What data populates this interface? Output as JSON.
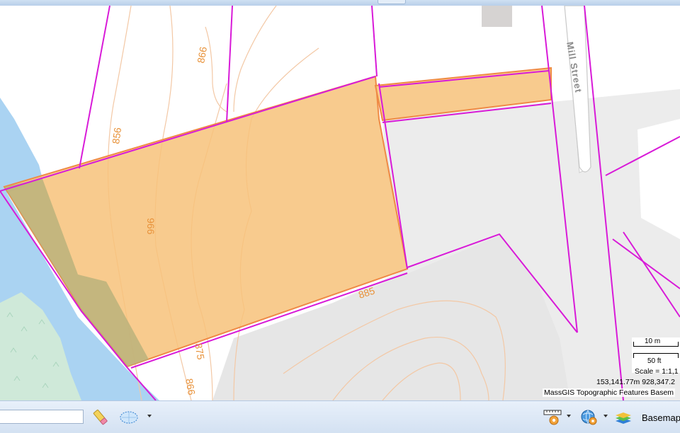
{
  "map": {
    "street_name": "Mill Street",
    "contour_labels": [
      "866",
      "856",
      "966",
      "885",
      "875",
      "866"
    ],
    "scale": {
      "metric_label": "10 m",
      "imperial_label": "50 ft",
      "ratio_text": "Scale = 1:1,1"
    },
    "coordinates_text": "153,141.77m 928,347.2",
    "attribution": "MassGIS Topographic Features Basem",
    "colors": {
      "parcel_boundary": "#d81ad8",
      "selection_fill": "#f7c27a",
      "selection_outline": "#ef8a45",
      "water": "#aad3f2",
      "contour": "#f3c8a5",
      "building": "#e9e9e9",
      "road": "#ffffff"
    }
  },
  "toolbar": {
    "search_placeholder": "",
    "search_value": "",
    "tools": [
      {
        "name": "eraser-icon"
      },
      {
        "name": "draw-shape-icon"
      },
      {
        "name": "measure-gear-icon"
      },
      {
        "name": "globe-gear-icon"
      },
      {
        "name": "basemap-layers-icon"
      }
    ],
    "basemaps_label": "Basemaps"
  }
}
